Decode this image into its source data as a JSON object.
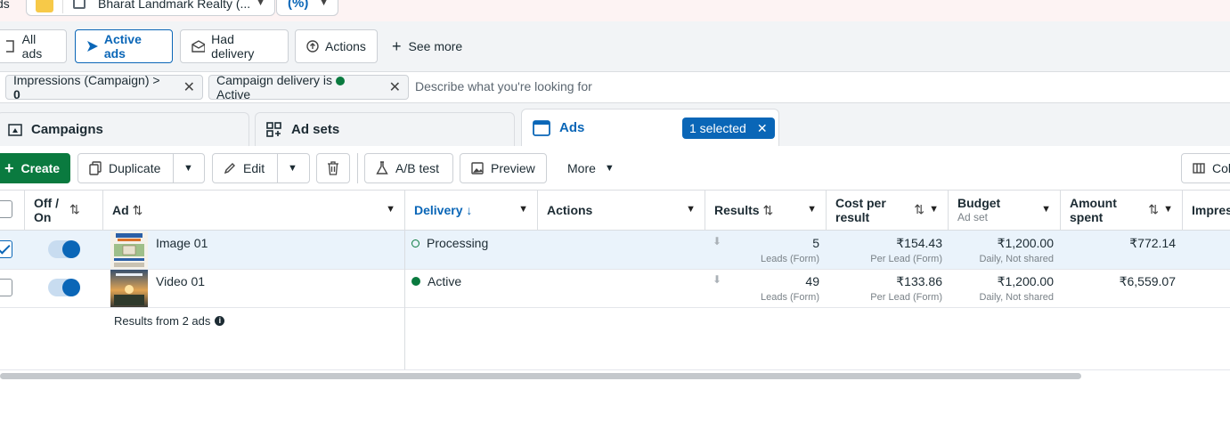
{
  "topbar": {
    "fragment": "ds",
    "account_name": "Bharat Landmark Realty (...",
    "small_selector": "(%)"
  },
  "quick_filters": {
    "all_ads": "All ads",
    "active_ads": "Active ads",
    "had_delivery": "Had delivery",
    "actions": "Actions",
    "see_more": "See more"
  },
  "filters": {
    "chip1_label": "Impressions (Campaign) >",
    "chip1_value": "0",
    "chip2_label": "Campaign delivery is",
    "chip2_value": "Active",
    "search_placeholder": "Describe what you're looking for"
  },
  "level_tabs": {
    "campaigns": "Campaigns",
    "ad_sets": "Ad sets",
    "ads": "Ads",
    "selected": "1 selected"
  },
  "toolbar": {
    "create": "Create",
    "duplicate": "Duplicate",
    "edit": "Edit",
    "ab_test": "A/B test",
    "preview": "Preview",
    "more": "More",
    "columns": "Col"
  },
  "table": {
    "headers": {
      "off_on": "Off /",
      "off_on_2": "On",
      "ad": "Ad",
      "delivery": "Delivery",
      "actions": "Actions",
      "results": "Results",
      "cost_per_result": "Cost per",
      "cost_per_result_2": "result",
      "budget": "Budget",
      "budget_sub": "Ad set",
      "amount_spent": "Amount",
      "amount_spent_2": "spent",
      "impressions": "Impress"
    },
    "rows": [
      {
        "name": "Image 01",
        "selected": true,
        "delivery": "Processing",
        "results": "5",
        "results_sub": "Leads (Form)",
        "cost": "₹154.43",
        "cost_sub": "Per Lead (Form)",
        "budget": "₹1,200.00",
        "budget_sub": "Daily, Not shared",
        "spent": "₹772.14"
      },
      {
        "name": "Video 01",
        "selected": false,
        "delivery": "Active",
        "results": "49",
        "results_sub": "Leads (Form)",
        "cost": "₹133.86",
        "cost_sub": "Per Lead (Form)",
        "budget": "₹1,200.00",
        "budget_sub": "Daily, Not shared",
        "spent": "₹6,559.07"
      }
    ],
    "summary": "Results from 2 ads"
  },
  "colors": {
    "accent": "#0a66b7",
    "create_green": "#0a7a3f",
    "active_dot": "#0a7a3f"
  }
}
